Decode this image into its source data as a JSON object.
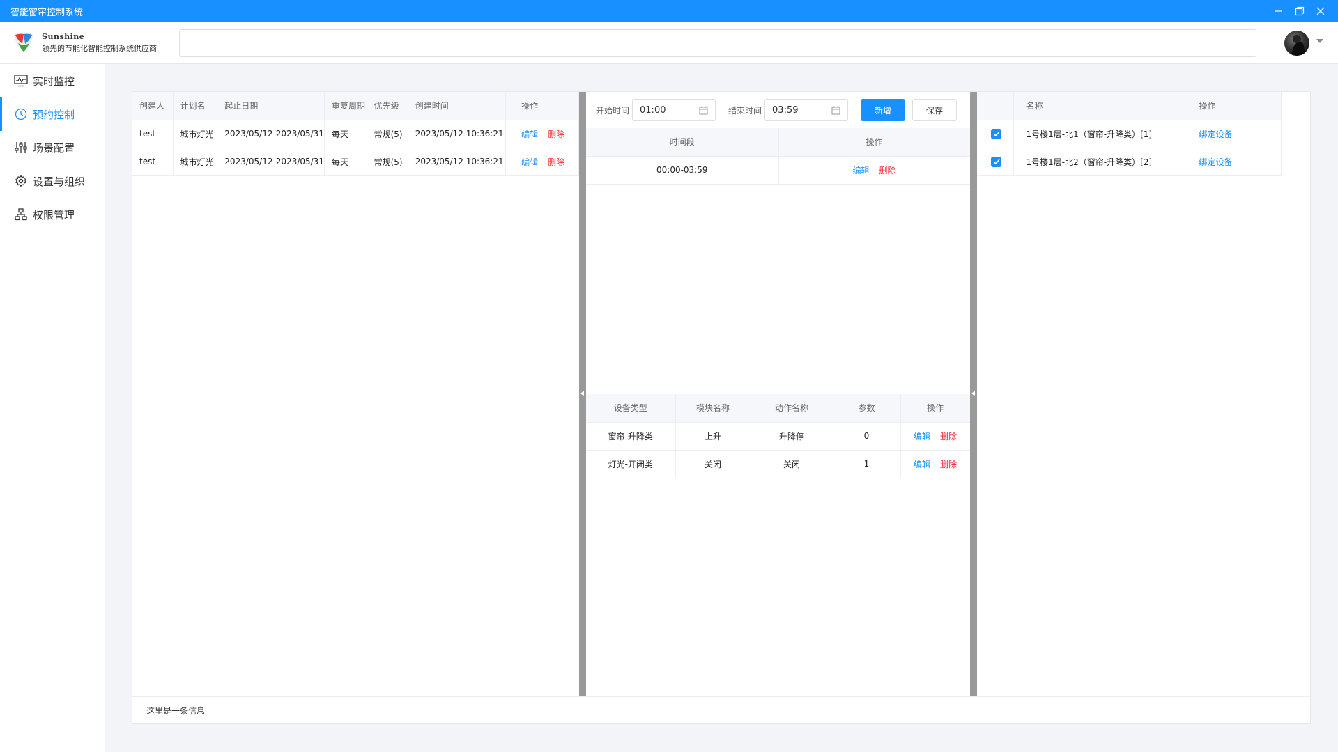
{
  "window": {
    "title": "智能窗帘控制系统"
  },
  "header": {
    "brand": "Sunshine",
    "tagline": "领先的节能化智能控制系统供应商",
    "search_value": ""
  },
  "sidebar": {
    "items": [
      {
        "label": "实时监控",
        "icon": "monitor-icon"
      },
      {
        "label": "预约控制",
        "icon": "clock-icon",
        "active": true
      },
      {
        "label": "场景配置",
        "icon": "sliders-icon"
      },
      {
        "label": "设置与组织",
        "icon": "gear-icon"
      },
      {
        "label": "权限管理",
        "icon": "org-tree-icon"
      }
    ]
  },
  "plans": {
    "headers": [
      "创建人",
      "计划名",
      "起止日期",
      "重复周期",
      "优先级",
      "创建时间",
      "操作"
    ],
    "rows": [
      {
        "creator": "test",
        "name": "城市灯光",
        "dates": "2023/05/12-2023/05/31",
        "repeat": "每天",
        "priority": "常规(5)",
        "created": "2023/05/12 10:36:21",
        "edit": "编辑",
        "delete": "删除"
      },
      {
        "creator": "test",
        "name": "城市灯光",
        "dates": "2023/05/12-2023/05/31",
        "repeat": "每天",
        "priority": "常规(5)",
        "created": "2023/05/12 10:36:21",
        "edit": "编辑",
        "delete": "删除"
      }
    ]
  },
  "timeslots": {
    "start_label": "开始时间",
    "start_value": "01:00",
    "end_label": "结束时间",
    "end_value": "03:59",
    "add_label": "新增",
    "save_label": "保存",
    "headers": [
      "时间段",
      "操作"
    ],
    "rows": [
      {
        "period": "00:00-03:59",
        "edit": "编辑",
        "delete": "删除"
      }
    ]
  },
  "actions": {
    "headers": [
      "设备类型",
      "模块名称",
      "动作名称",
      "参数",
      "操作"
    ],
    "rows": [
      {
        "device_type": "窗帘-升降类",
        "module": "上升",
        "action": "升降停",
        "param": "0",
        "edit": "编辑",
        "delete": "删除"
      },
      {
        "device_type": "灯光-开闭类",
        "module": "关闭",
        "action": "关闭",
        "param": "1",
        "edit": "编辑",
        "delete": "删除"
      }
    ]
  },
  "devices": {
    "headers": [
      "",
      "名称",
      "操作"
    ],
    "rows": [
      {
        "checked": true,
        "name": "1号楼1层-北1（窗帘-升降类）[1]",
        "bind": "绑定设备"
      },
      {
        "checked": true,
        "name": "1号楼1层-北2（窗帘-升降类）[2]",
        "bind": "绑定设备"
      }
    ]
  },
  "footer": {
    "message": "这里是一条信息"
  },
  "colors": {
    "primary": "#1890ff",
    "danger": "#f5222d",
    "splitter": "#999999"
  }
}
